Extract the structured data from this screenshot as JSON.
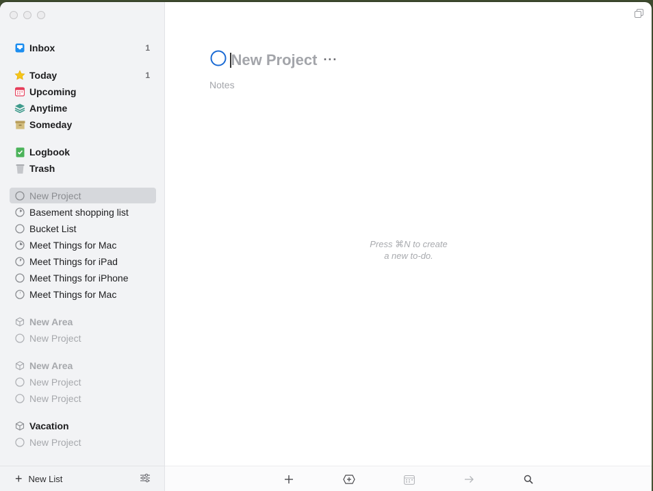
{
  "sidebar": {
    "nav": [
      {
        "label": "Inbox",
        "count": "1",
        "icon": "inbox-icon"
      },
      {
        "label": "Today",
        "count": "1",
        "icon": "star-icon"
      },
      {
        "label": "Upcoming",
        "count": "",
        "icon": "calendar-icon"
      },
      {
        "label": "Anytime",
        "count": "",
        "icon": "layers-icon"
      },
      {
        "label": "Someday",
        "count": "",
        "icon": "box-icon"
      },
      {
        "label": "Logbook",
        "count": "",
        "icon": "logbook-icon"
      },
      {
        "label": "Trash",
        "count": "",
        "icon": "trash-icon"
      }
    ],
    "projects": [
      {
        "label": "New Project",
        "icon": "circle-icon"
      },
      {
        "label": "Basement shopping list",
        "icon": "progress-circle-icon"
      },
      {
        "label": "Bucket List",
        "icon": "circle-icon"
      },
      {
        "label": "Meet Things for Mac",
        "icon": "progress-circle-icon"
      },
      {
        "label": "Meet Things for iPad",
        "icon": "progress-circle-icon"
      },
      {
        "label": "Meet Things for iPhone",
        "icon": "circle-icon"
      },
      {
        "label": "Meet Things for Mac",
        "icon": "progress-circle-icon"
      }
    ],
    "areas": [
      {
        "label": "New Area",
        "projects": [
          "New Project"
        ]
      },
      {
        "label": "New Area",
        "projects": [
          "New Project",
          "New Project"
        ]
      },
      {
        "label": "Vacation",
        "projects": [
          "New Project"
        ]
      }
    ],
    "new_list_label": "New List"
  },
  "main": {
    "title": "New Project",
    "more_label": "···",
    "notes_placeholder": "Notes",
    "hint_line1": "Press ⌘N to create",
    "hint_line2": "a new to-do."
  },
  "colors": {
    "accent": "#1a6ad4",
    "today_star": "#f5c518",
    "upcoming": "#e63d5a",
    "anytime": "#3f9b8c",
    "someday": "#c9b06a",
    "logbook": "#4bb35a"
  }
}
